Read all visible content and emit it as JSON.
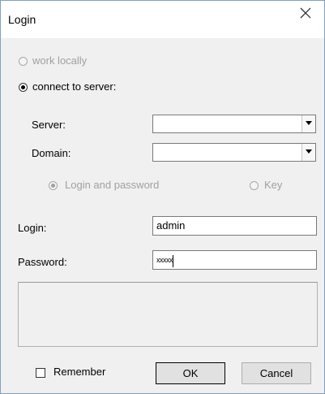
{
  "window": {
    "title": "Login",
    "close_symbol": "×"
  },
  "mode": {
    "work_locally_label": "work locally",
    "connect_to_server_label": "connect to server:",
    "selected": "connect_to_server"
  },
  "server": {
    "label": "Server:",
    "value": ""
  },
  "domain": {
    "label": "Domain:",
    "value": ""
  },
  "auth": {
    "login_and_password_label": "Login and password",
    "key_label": "Key",
    "selected": "login_and_password"
  },
  "login": {
    "label": "Login:",
    "value": "admin"
  },
  "password": {
    "label": "Password:",
    "masked_value": "xxxxx"
  },
  "remember": {
    "label": "Remember",
    "checked": false
  },
  "buttons": {
    "ok_label": "OK",
    "cancel_label": "Cancel"
  },
  "icons": {
    "close": "close-icon",
    "combo_arrow": "chevron-down-icon"
  },
  "colors": {
    "window_bg": "#f0f0f0",
    "titlebar_bg": "#ffffff",
    "disabled_text": "#a0a0a0"
  }
}
